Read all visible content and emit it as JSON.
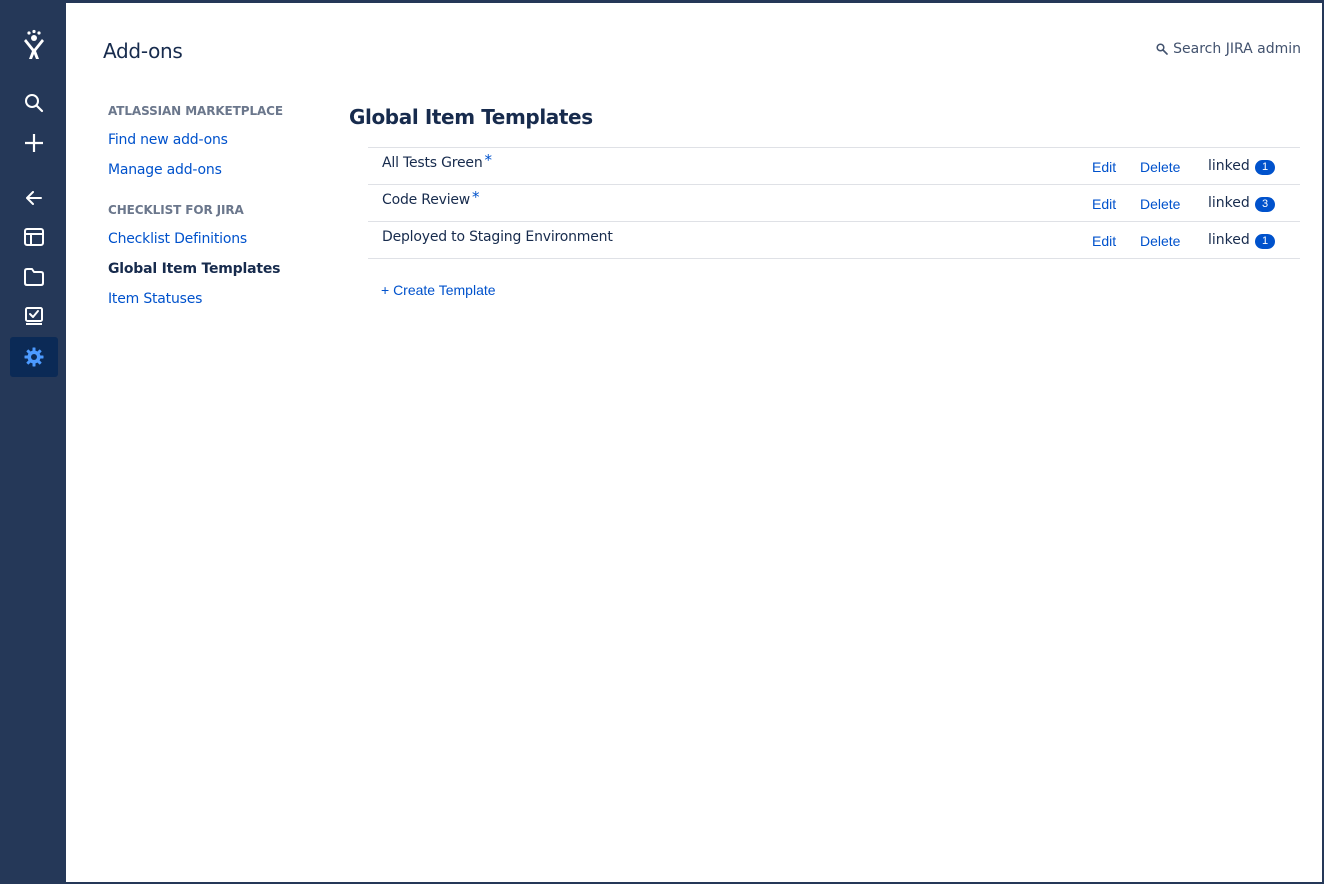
{
  "global_nav": {
    "icons": [
      "jira-logo-icon",
      "search-icon",
      "create-icon",
      "back-arrow-icon",
      "board-icon",
      "projects-folder-icon",
      "checklist-icon",
      "settings-gear-icon"
    ],
    "active_color": "#4c9aff"
  },
  "header": {
    "title": "Add-ons",
    "search_label": "Search JIRA admin"
  },
  "sidebar": {
    "sections": [
      {
        "heading": "ATLASSIAN MARKETPLACE",
        "items": [
          {
            "label": "Find new add-ons"
          },
          {
            "label": "Manage add-ons"
          }
        ]
      },
      {
        "heading": "CHECKLIST FOR JIRA",
        "items": [
          {
            "label": "Checklist Definitions"
          },
          {
            "label": "Global Item Templates",
            "selected": true
          },
          {
            "label": "Item Statuses"
          }
        ]
      }
    ]
  },
  "content": {
    "title": "Global Item Templates",
    "templates": [
      {
        "name": "All Tests Green",
        "star": "*",
        "edit": "Edit",
        "delete": "Delete",
        "linked": "linked",
        "count": "1"
      },
      {
        "name": "Code Review",
        "star": "*",
        "edit": "Edit",
        "delete": "Delete",
        "linked": "linked",
        "count": "3"
      },
      {
        "name": "Deployed to Staging Environment",
        "star": "",
        "edit": "Edit",
        "delete": "Delete",
        "linked": "linked",
        "count": "1"
      }
    ],
    "create_label": "+ Create Template"
  },
  "colors": {
    "nav_bg": "#253858",
    "link": "#0052cc",
    "text": "#172b4d",
    "badge_bg": "#0052cc"
  }
}
